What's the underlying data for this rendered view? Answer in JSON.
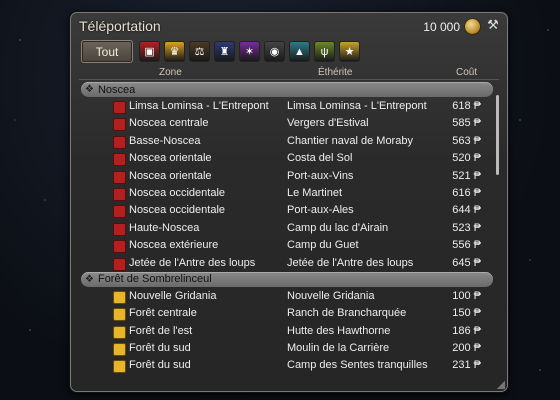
{
  "window": {
    "title": "Téléportation",
    "gil_amount": "10 000",
    "gil_icon": "gil-coin-icon",
    "tools_icon": "tools-icon"
  },
  "filters": {
    "all_label": "Tout",
    "icons": [
      {
        "name": "la-noscea-icon",
        "color": "#b32020",
        "glyph": "▣"
      },
      {
        "name": "black-shroud-icon",
        "color": "#e0a21c",
        "glyph": "♛"
      },
      {
        "name": "thanalan-icon",
        "color": "#4b3a20",
        "glyph": "⚖"
      },
      {
        "name": "coerthas-icon",
        "color": "#2b3a78",
        "glyph": "♜"
      },
      {
        "name": "mor-dhona-icon",
        "color": "#7a2a9a",
        "glyph": "✶"
      },
      {
        "name": "abalathia-icon",
        "color": "#444444",
        "glyph": "◉"
      },
      {
        "name": "dravania-icon",
        "color": "#2b7d8a",
        "glyph": "▲"
      },
      {
        "name": "gyr-abania-icon",
        "color": "#6b8a22",
        "glyph": "ψ"
      },
      {
        "name": "favorites-icon",
        "color": "#c9a228",
        "glyph": "★"
      }
    ]
  },
  "columns": {
    "zone": "Zone",
    "aetheryte": "Éthérite",
    "cost": "Coût"
  },
  "currency_symbol": "₱",
  "groups": [
    {
      "name": "Noscea",
      "icon_color": "red",
      "rows": [
        {
          "zone": "Limsa Lominsa - L'Entrepont",
          "aetheryte": "Limsa Lominsa - L'Entrepont",
          "cost": "618 ₱"
        },
        {
          "zone": "Noscea centrale",
          "aetheryte": "Vergers d'Estival",
          "cost": "585 ₱"
        },
        {
          "zone": "Basse-Noscea",
          "aetheryte": "Chantier naval de Moraby",
          "cost": "563 ₱"
        },
        {
          "zone": "Noscea orientale",
          "aetheryte": "Costa del Sol",
          "cost": "520 ₱"
        },
        {
          "zone": "Noscea orientale",
          "aetheryte": "Port-aux-Vins",
          "cost": "521 ₱"
        },
        {
          "zone": "Noscea occidentale",
          "aetheryte": "Le Martinet",
          "cost": "616 ₱"
        },
        {
          "zone": "Noscea occidentale",
          "aetheryte": "Port-aux-Ales",
          "cost": "644 ₱"
        },
        {
          "zone": "Haute-Noscea",
          "aetheryte": "Camp du lac d'Airain",
          "cost": "523 ₱"
        },
        {
          "zone": "Noscea extérieure",
          "aetheryte": "Camp du Guet",
          "cost": "556 ₱"
        },
        {
          "zone": "Jetée de l'Antre des loups",
          "aetheryte": "Jetée de l'Antre des loups",
          "cost": "645 ₱"
        }
      ]
    },
    {
      "name": "Forêt de Sombrelinceul",
      "icon_color": "yellow",
      "rows": [
        {
          "zone": "Nouvelle Gridania",
          "aetheryte": "Nouvelle Gridania",
          "cost": "100 ₱"
        },
        {
          "zone": "Forêt centrale",
          "aetheryte": "Ranch de Brancharquée",
          "cost": "150 ₱"
        },
        {
          "zone": "Forêt de l'est",
          "aetheryte": "Hutte des Hawthorne",
          "cost": "186 ₱"
        },
        {
          "zone": "Forêt du sud",
          "aetheryte": "Moulin de la Carrière",
          "cost": "200 ₱"
        },
        {
          "zone": "Forêt du sud",
          "aetheryte": "Camp des Sentes tranquilles",
          "cost": "231 ₱"
        }
      ]
    }
  ]
}
